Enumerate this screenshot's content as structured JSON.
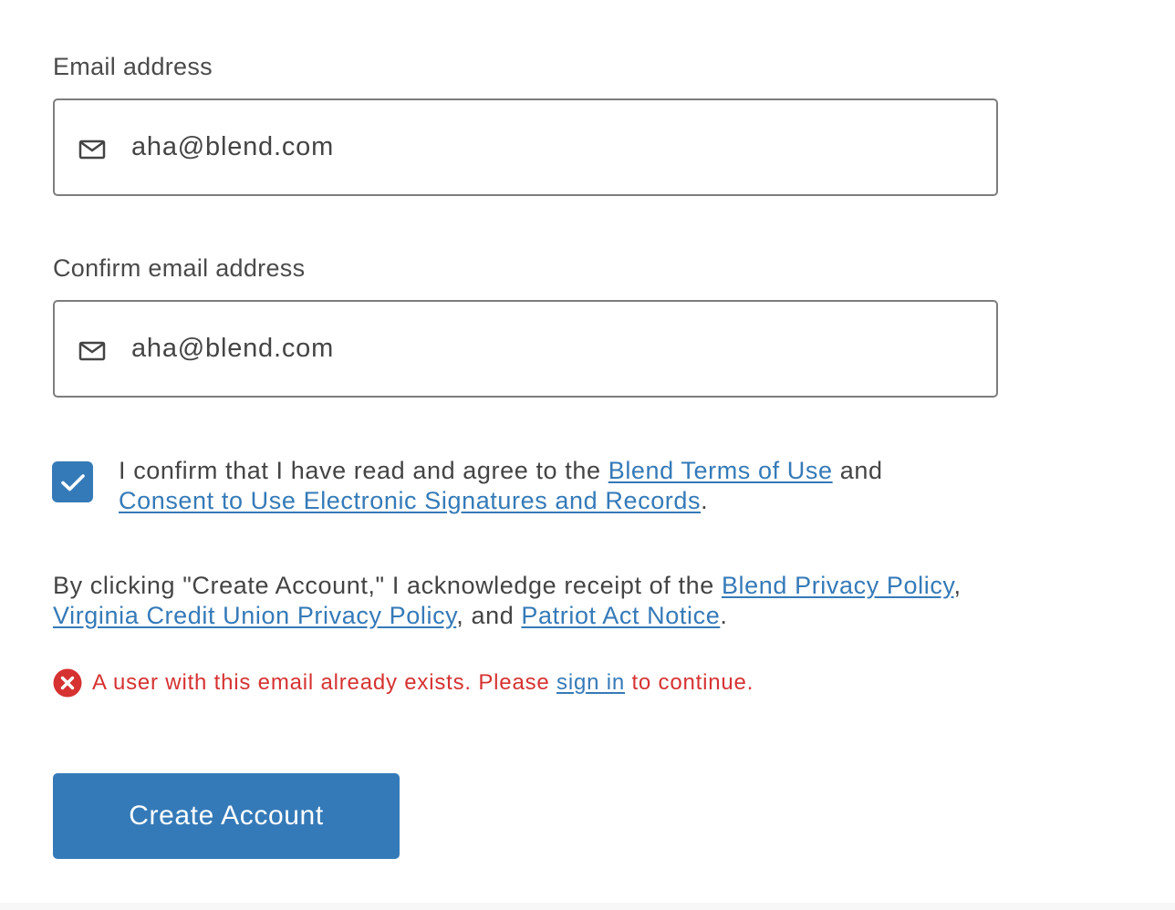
{
  "email": {
    "label": "Email address",
    "value": "aha@blend.com",
    "icon": "mail-icon"
  },
  "confirm_email": {
    "label": "Confirm email address",
    "value": "aha@blend.com",
    "icon": "mail-icon"
  },
  "consent": {
    "checked": true,
    "text_before": "I confirm that I have read and agree to the ",
    "terms_link": "Blend Terms of Use",
    "text_middle": " and",
    "esign_link": "Consent to Use Electronic Signatures and Records",
    "text_after": "."
  },
  "acknowledgement": {
    "text_before": "By clicking \"Create Account,\" I acknowledge receipt of the ",
    "blend_privacy_link": "Blend Privacy Policy",
    "comma": ",",
    "vcu_privacy_link": "Virginia Credit Union Privacy Policy",
    "text_and": ", and ",
    "patriot_link": "Patriot Act Notice",
    "text_after": "."
  },
  "error": {
    "icon": "error-icon",
    "text_before": "A user with this email already exists. Please ",
    "sign_in_link": "sign in",
    "text_after": " to continue."
  },
  "actions": {
    "create_label": "Create Account"
  },
  "colors": {
    "accent": "#357ab8",
    "error": "#d63232",
    "text": "#444444",
    "border": "#7d7d7d"
  }
}
